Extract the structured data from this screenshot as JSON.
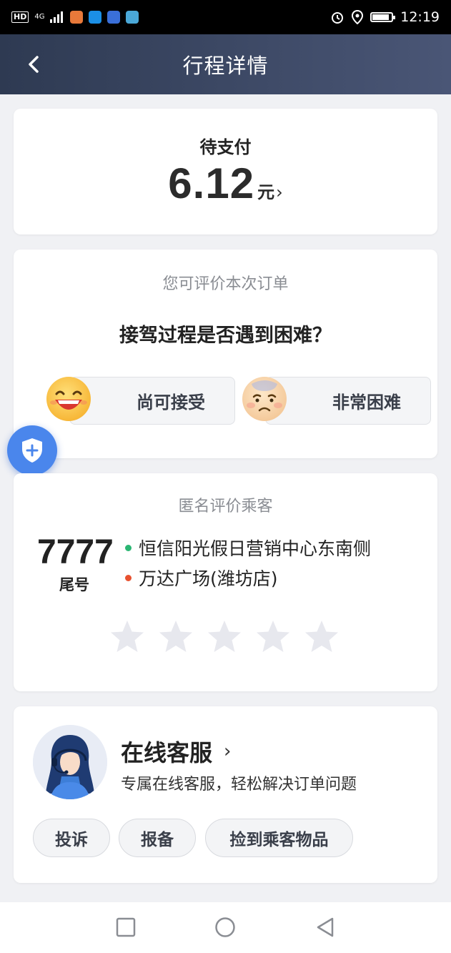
{
  "status_bar": {
    "time": "12:19",
    "network": "4G",
    "hd": "HD",
    "battery_level": 0.9,
    "app_icons": [
      "app-icon-orange",
      "alipay-icon",
      "baidu-icon",
      "browser-icon"
    ]
  },
  "header": {
    "title": "行程详情",
    "back_icon": "chevron-left-icon"
  },
  "payment": {
    "status": "待支付",
    "amount": "6.12",
    "unit": "元",
    "chevron": "›"
  },
  "rating": {
    "hint": "您可评价本次订单",
    "question": "接驾过程是否遇到困难？",
    "options": [
      {
        "label": "尚可接受",
        "icon": "happy-face-icon"
      },
      {
        "label": "非常困难",
        "icon": "sad-face-icon"
      }
    ]
  },
  "safety_button": {
    "icon": "shield-plus-icon"
  },
  "passenger": {
    "title": "匿名评价乘客",
    "tail_number": "7777",
    "tail_label": "尾号",
    "start": "恒信阳光假日营销中心东南侧",
    "end": "万达广场(潍坊店)",
    "start_color": "#2bb673",
    "end_color": "#e8512f",
    "stars_total": 5,
    "stars_selected": 0
  },
  "service": {
    "title": "在线客服",
    "chevron": "›",
    "subtitle": "专属在线客服，轻松解决订单问题",
    "buttons": [
      "投诉",
      "报备",
      "捡到乘客物品"
    ]
  },
  "nav_bar": {
    "icons": [
      "recent-apps-icon",
      "home-icon",
      "back-icon"
    ]
  },
  "colors": {
    "header_gradient_start": "#2e3a52",
    "header_gradient_end": "#4a5676",
    "background": "#f0f1f4",
    "fab": "#4a86ec",
    "star_empty": "#e7e8ee"
  }
}
